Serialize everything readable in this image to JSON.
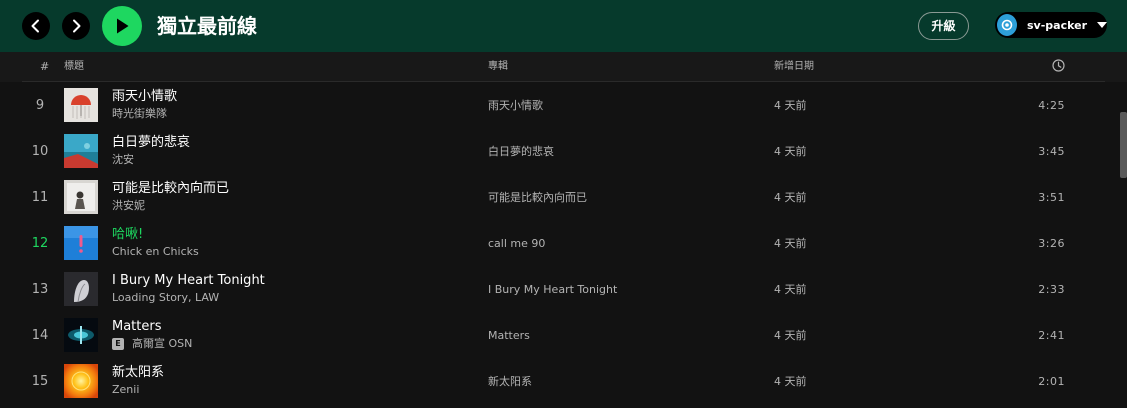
{
  "header": {
    "title": "獨立最前線",
    "upgrade_label": "升級",
    "user_name": "sv-packer"
  },
  "columns": {
    "number": "#",
    "title": "標題",
    "album": "專輯",
    "date_added": "新增日期"
  },
  "tracks": [
    {
      "number": "9",
      "title": "雨天小情歌",
      "artist": "時光街樂隊",
      "explicit": false,
      "album": "雨天小情歌",
      "added": "4 天前",
      "duration": "4:25",
      "playing": false
    },
    {
      "number": "10",
      "title": "白日夢的悲哀",
      "artist": "沈安",
      "explicit": false,
      "album": "白日夢的悲哀",
      "added": "4 天前",
      "duration": "3:45",
      "playing": false
    },
    {
      "number": "11",
      "title": "可能是比較內向而已",
      "artist": "洪安妮",
      "explicit": false,
      "album": "可能是比較內向而已",
      "added": "4 天前",
      "duration": "3:51",
      "playing": false
    },
    {
      "number": "12",
      "title": "哈啾!",
      "artist": "Chick en Chicks",
      "explicit": false,
      "album": "call me 90",
      "added": "4 天前",
      "duration": "3:26",
      "playing": true
    },
    {
      "number": "13",
      "title": "I Bury My Heart Tonight",
      "artist": "Loading Story, LAW",
      "explicit": false,
      "album": "I Bury My Heart Tonight",
      "added": "4 天前",
      "duration": "2:33",
      "playing": false
    },
    {
      "number": "14",
      "title": "Matters",
      "artist": "高爾宣 OSN",
      "explicit": true,
      "explicit_label": "E",
      "album": "Matters",
      "added": "4 天前",
      "duration": "2:41",
      "playing": false
    },
    {
      "number": "15",
      "title": "新太阳系",
      "artist": "Zenii",
      "explicit": false,
      "album": "新太阳系",
      "added": "4 天前",
      "duration": "2:01",
      "playing": false
    }
  ],
  "colors": {
    "header_bg": "#063a2c",
    "page_bg": "#121212",
    "accent_green": "#1ed760",
    "text_secondary": "#b3b3b3",
    "avatar_blue": "#2d9fd8"
  },
  "icons": {
    "back": "chevron-left-icon",
    "forward": "chevron-right-icon",
    "play": "play-icon",
    "duration": "clock-icon",
    "user_menu": "caret-down-icon"
  }
}
